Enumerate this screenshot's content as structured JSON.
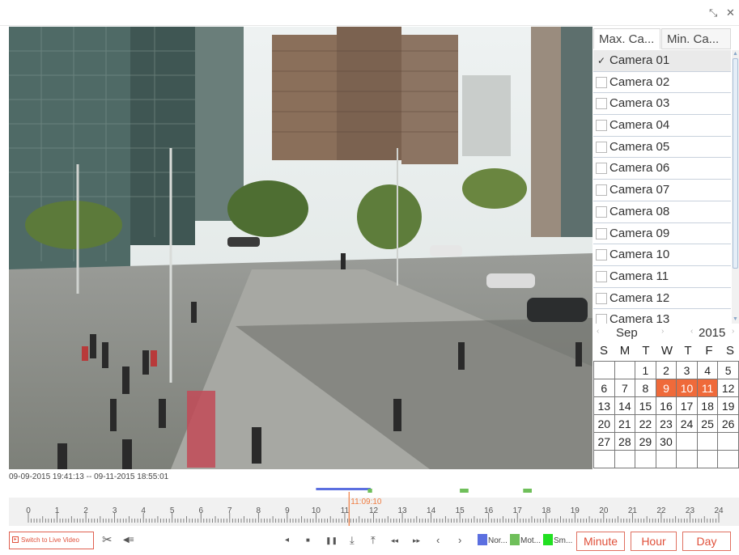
{
  "window": {
    "fullscreen_icon": "⤡",
    "close_icon": "✕"
  },
  "video": {
    "description_name": "street-scene"
  },
  "tabs": [
    {
      "label": "Max. Ca..."
    },
    {
      "label": "Min. Ca..."
    }
  ],
  "cameras": [
    {
      "label": "Camera 01",
      "checked": true
    },
    {
      "label": "Camera 02",
      "checked": false
    },
    {
      "label": "Camera 03",
      "checked": false
    },
    {
      "label": "Camera 04",
      "checked": false
    },
    {
      "label": "Camera 05",
      "checked": false
    },
    {
      "label": "Camera 06",
      "checked": false
    },
    {
      "label": "Camera 07",
      "checked": false
    },
    {
      "label": "Camera 08",
      "checked": false
    },
    {
      "label": "Camera 09",
      "checked": false
    },
    {
      "label": "Camera 10",
      "checked": false
    },
    {
      "label": "Camera 11",
      "checked": false
    },
    {
      "label": "Camera 12",
      "checked": false
    },
    {
      "label": "Camera 13",
      "checked": false
    }
  ],
  "calendar": {
    "month": "Sep",
    "year": "2015",
    "prev_month": "‹",
    "next_month": "›",
    "prev_year": "‹",
    "next_year": "›",
    "weekdays": [
      "S",
      "M",
      "T",
      "W",
      "T",
      "F",
      "S"
    ],
    "weeks": [
      [
        "",
        "",
        "1",
        "2",
        "3",
        "4",
        "5"
      ],
      [
        "6",
        "7",
        "8",
        "9",
        "10",
        "11",
        "12"
      ],
      [
        "13",
        "14",
        "15",
        "16",
        "17",
        "18",
        "19"
      ],
      [
        "20",
        "21",
        "22",
        "23",
        "24",
        "25",
        "26"
      ],
      [
        "27",
        "28",
        "29",
        "30",
        "",
        "",
        ""
      ],
      [
        "",
        "",
        "",
        "",
        "",
        "",
        ""
      ]
    ],
    "recorded_days": [
      "9",
      "10",
      "11"
    ],
    "selected_day": "11"
  },
  "timeline": {
    "range_text": "09-09-2015 19:41:13 -- 09-11-2015 18:55:01",
    "cursor_time": "11:09:10",
    "cursor_hour": 11.15,
    "hour_labels": [
      "0",
      "1",
      "2",
      "3",
      "4",
      "5",
      "6",
      "7",
      "8",
      "9",
      "10",
      "11",
      "12",
      "13",
      "14",
      "15",
      "16",
      "17",
      "18",
      "19",
      "20",
      "21",
      "22",
      "23",
      "24"
    ],
    "normal_segments": [
      [
        10.0,
        11.9
      ]
    ],
    "motion_segments": [
      [
        11.8,
        11.95
      ],
      [
        15.0,
        15.3
      ],
      [
        17.2,
        17.5
      ]
    ],
    "colors": {
      "normal": "#5b6fe0",
      "motion": "#6fbf5a",
      "smart": "#22e022",
      "cursor": "#f07b3f"
    }
  },
  "controls": {
    "live_label": "Switch to Live Video",
    "clip_icon": "✂",
    "volume_icon": "◀≡",
    "prev_frame": "◂",
    "stop": "■",
    "pause": "❚❚",
    "slow": "⤓",
    "fast": "⤒",
    "rewind": "◂◂",
    "forward": "▸▸",
    "prev_seg": "‹",
    "next_seg": "›"
  },
  "legend": [
    {
      "label": "Nor...",
      "color": "#5b6fe0"
    },
    {
      "label": "Mot...",
      "color": "#6fbf5a"
    },
    {
      "label": "Sm...",
      "color": "#22e022"
    }
  ],
  "zoom": {
    "minute": "Minute",
    "hour": "Hour",
    "day": "Day"
  }
}
